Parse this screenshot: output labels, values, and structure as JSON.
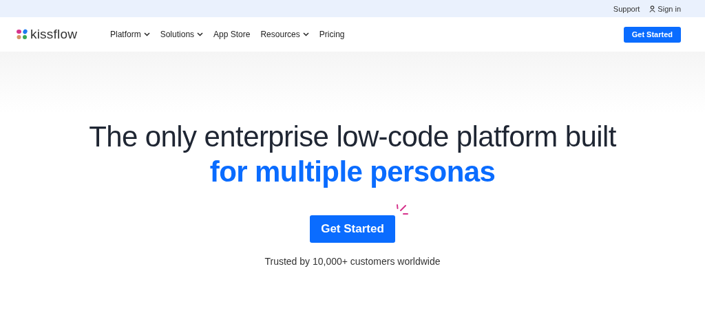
{
  "utility_bar": {
    "links": [
      "Support",
      "Sign in"
    ]
  },
  "header": {
    "logo": "kissflow",
    "nav": [
      {
        "label": "Platform",
        "dropdown": true
      },
      {
        "label": "Solutions",
        "dropdown": true
      },
      {
        "label": "App Store",
        "dropdown": false
      },
      {
        "label": "Resources",
        "dropdown": true
      },
      {
        "label": "Pricing",
        "dropdown": false
      }
    ],
    "cta": "Get Started"
  },
  "hero": {
    "headline": "The only enterprise low-code platform built",
    "headline_accent": "for multiple personas",
    "cta": "Get Started",
    "trust_line": "Trusted by 10,000+ customers worldwide"
  }
}
